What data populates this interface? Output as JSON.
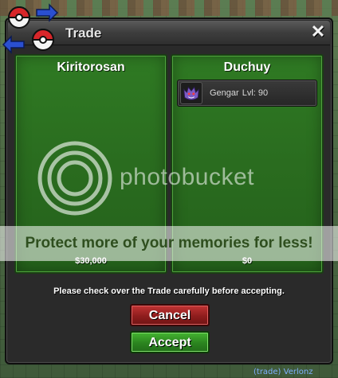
{
  "window": {
    "title": "Trade",
    "close_glyph": "✕"
  },
  "left_panel": {
    "player_name": "Kiritorosan",
    "money": "$30,000",
    "pokemon": []
  },
  "right_panel": {
    "player_name": "Duchuy",
    "money": "$0",
    "pokemon": [
      {
        "name": "Gengar",
        "level": "Lvl: 90",
        "icon": "gengar-sprite-icon"
      }
    ]
  },
  "footer": {
    "note": "Please check over the Trade carefully before accepting.",
    "cancel_label": "Cancel",
    "accept_label": "Accept"
  },
  "watermark": {
    "word": "photobucket",
    "band_text": "Protect more of your memories for less!"
  },
  "chat_snippet": "(trade) Verlonz",
  "colors": {
    "panel_green": "#2f7a23",
    "cancel_red": "#c23434",
    "accept_green": "#44b431",
    "window_dark": "#2a2a2a"
  }
}
